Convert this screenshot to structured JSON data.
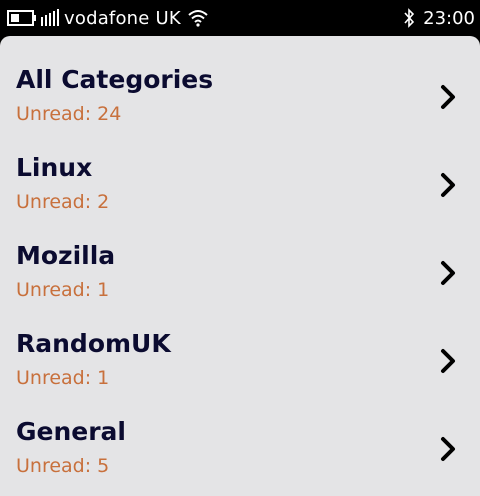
{
  "status_bar": {
    "carrier": "vodafone UK",
    "time": "23:00",
    "icons": [
      "battery-icon",
      "signal-icon",
      "wifi-icon",
      "bluetooth-icon"
    ]
  },
  "categories": [
    {
      "name": "All Categories",
      "unread": "Unread: 24"
    },
    {
      "name": "Linux",
      "unread": "Unread: 2"
    },
    {
      "name": "Mozilla",
      "unread": "Unread: 1"
    },
    {
      "name": "RandomUK",
      "unread": "Unread: 1"
    },
    {
      "name": "General",
      "unread": "Unread: 5"
    }
  ],
  "colors": {
    "title": "#0b0b30",
    "unread": "#c8703c",
    "panel": "#e4e4e6"
  }
}
